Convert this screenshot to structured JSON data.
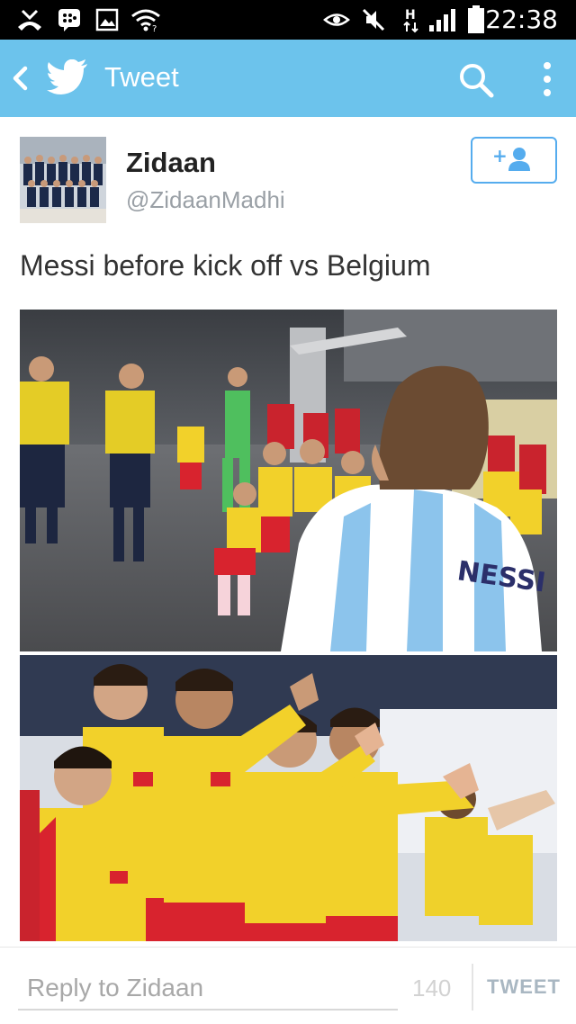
{
  "status_bar": {
    "time": "22:38",
    "icons": [
      "missed-call-icon",
      "bbm-icon",
      "image-icon",
      "wifi-icon",
      "eye-icon",
      "mute-icon",
      "network-h-icon",
      "signal-icon",
      "battery-icon"
    ]
  },
  "action_bar": {
    "title": "Tweet",
    "icons": [
      "back-icon",
      "twitter-bird-icon",
      "search-icon",
      "overflow-menu-icon"
    ],
    "color": "#6cc3ec"
  },
  "tweet": {
    "author_name": "Zidaan",
    "author_handle": "@ZidaanMadhi",
    "text": "Messi before kick off vs Belgium",
    "follow_icon": "add-user-icon"
  },
  "reply_bar": {
    "placeholder": "Reply to Zidaan",
    "char_count": "140",
    "tweet_label": "TWEET"
  },
  "colors": {
    "accent": "#55acee",
    "action_bar": "#6cc3ec",
    "status_bar": "#000000",
    "kit_yellow": "#f2d12a",
    "kit_red": "#d8232e"
  }
}
